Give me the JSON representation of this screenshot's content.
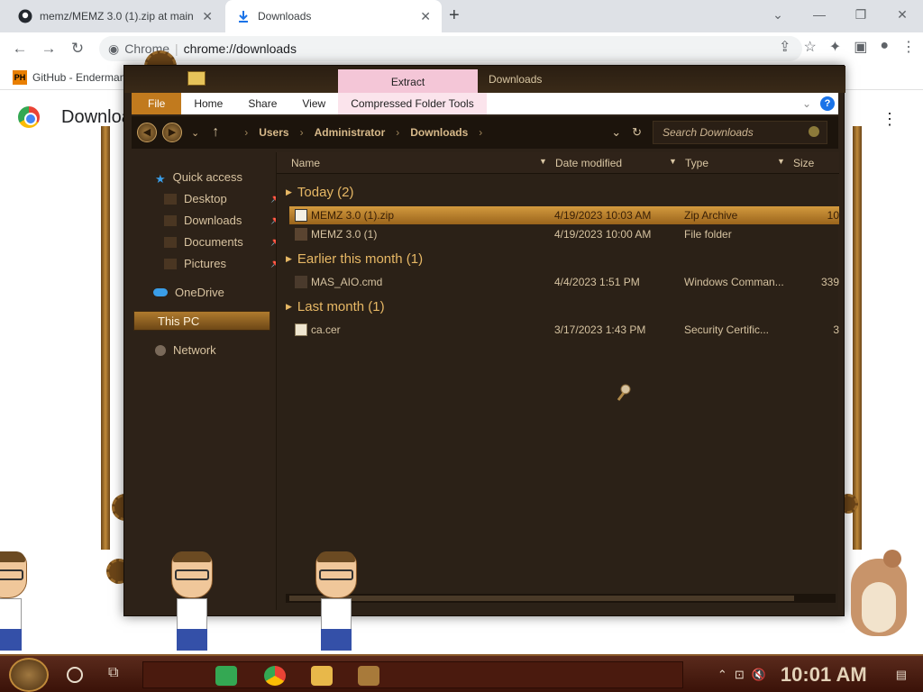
{
  "browser": {
    "tabs": [
      {
        "label": "memz/MEMZ 3.0 (1).zip at main",
        "icon": "github-icon"
      },
      {
        "label": "Downloads",
        "icon": "download-icon"
      }
    ],
    "new_tab": "+",
    "window_controls": {
      "chevron": "⌄",
      "minimize": "—",
      "restore": "❐",
      "close": "✕"
    },
    "omnibox": {
      "site_label": "Chrome",
      "url": "chrome://downloads"
    },
    "bookmarks": [
      {
        "label": "GitHub - Enderman",
        "icon": "PH"
      }
    ],
    "downloads_title": "Downloads"
  },
  "explorer": {
    "window_title": "Downloads",
    "contextual_tab": "Extract",
    "ribbon": {
      "file": "File",
      "tabs": [
        "Home",
        "Share",
        "View"
      ],
      "compressed": "Compressed Folder Tools",
      "help": "?"
    },
    "breadcrumb": [
      "Users",
      "Administrator",
      "Downloads"
    ],
    "search_placeholder": "Search Downloads",
    "nav": {
      "quick_access": "Quick access",
      "quick_items": [
        "Desktop",
        "Downloads",
        "Documents",
        "Pictures"
      ],
      "onedrive": "OneDrive",
      "this_pc": "This PC",
      "network": "Network"
    },
    "columns": [
      "Name",
      "Date modified",
      "Type",
      "Size"
    ],
    "groups": [
      {
        "title": "Today (2)",
        "files": [
          {
            "name": "MEMZ 3.0 (1).zip",
            "date": "4/19/2023 10:03 AM",
            "type": "Zip Archive",
            "size": "10",
            "selected": true
          },
          {
            "name": "MEMZ 3.0 (1)",
            "date": "4/19/2023 10:00 AM",
            "type": "File folder",
            "size": "",
            "selected": false
          }
        ]
      },
      {
        "title": "Earlier this month (1)",
        "files": [
          {
            "name": "MAS_AIO.cmd",
            "date": "4/4/2023 1:51 PM",
            "type": "Windows Comman...",
            "size": "339",
            "selected": false
          }
        ]
      },
      {
        "title": "Last month (1)",
        "files": [
          {
            "name": "ca.cer",
            "date": "3/17/2023 1:43 PM",
            "type": "Security Certific...",
            "size": "3",
            "selected": false
          }
        ]
      }
    ]
  },
  "taskbar": {
    "clock": "10:01 AM",
    "colors": {
      "accent": "#c08a3a",
      "bar": "#4a1a0e"
    }
  }
}
